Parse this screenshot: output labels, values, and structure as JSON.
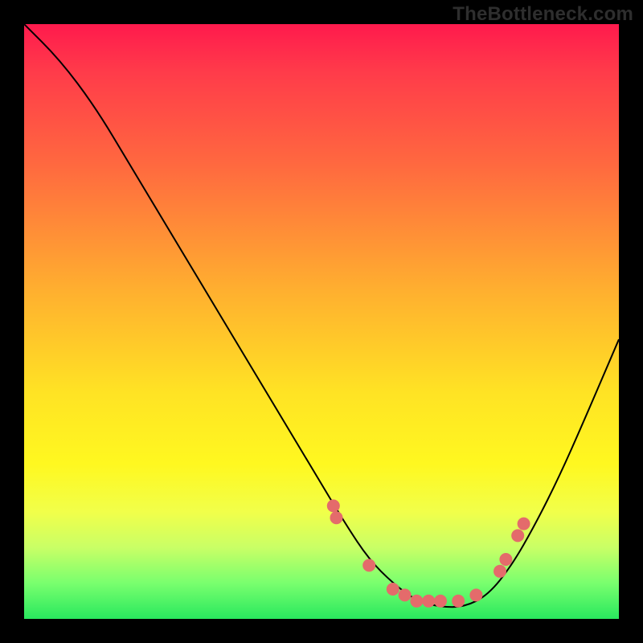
{
  "attribution": "TheBottleneck.com",
  "chart_data": {
    "type": "line",
    "title": "",
    "xlabel": "",
    "ylabel": "",
    "xlim": [
      0,
      100
    ],
    "ylim": [
      0,
      100
    ],
    "series": [
      {
        "name": "bottleneck-curve",
        "x": [
          0,
          6,
          12,
          18,
          24,
          30,
          36,
          42,
          48,
          54,
          58,
          62,
          66,
          70,
          74,
          78,
          82,
          86,
          90,
          94,
          100
        ],
        "y": [
          100,
          94,
          86,
          76,
          66,
          56,
          46,
          36,
          26,
          16,
          10,
          6,
          3,
          2,
          2,
          4,
          9,
          16,
          24,
          33,
          47
        ]
      }
    ],
    "points": {
      "name": "highlight-dots",
      "x": [
        52,
        52.5,
        58,
        62,
        64,
        66,
        68,
        70,
        73,
        76,
        80,
        81,
        83,
        84
      ],
      "y": [
        19,
        17,
        9,
        5,
        4,
        3,
        3,
        3,
        3,
        4,
        8,
        10,
        14,
        16
      ]
    },
    "background": {
      "top_color": "#ff1a4d",
      "mid_color": "#ffe324",
      "bottom_color": "#29e85e"
    }
  }
}
